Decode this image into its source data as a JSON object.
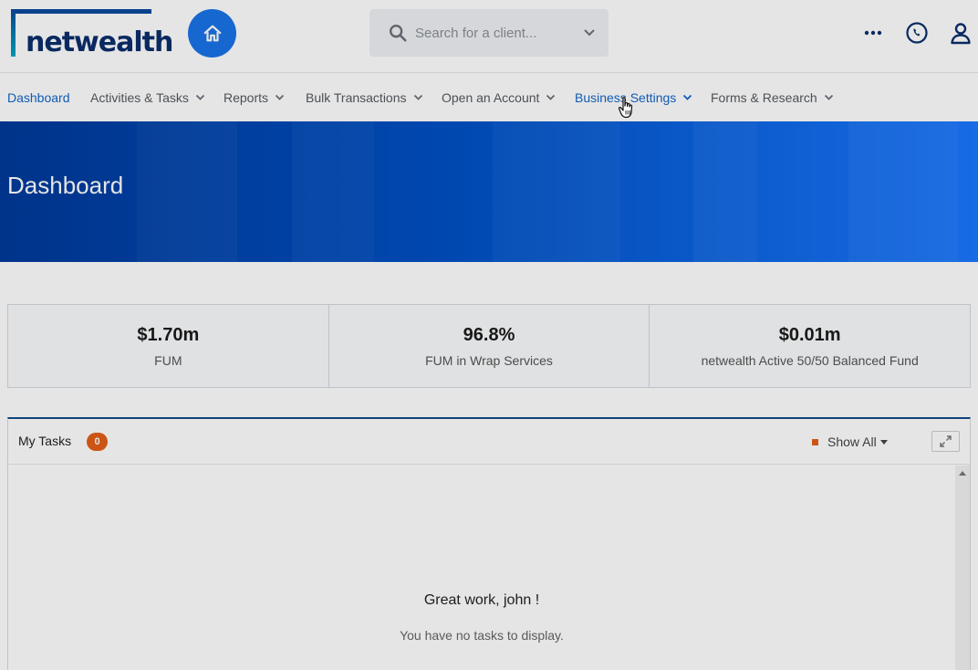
{
  "brand": {
    "name": "netwealth",
    "accent": "#1a73e8",
    "navy": "#0b2e6b"
  },
  "header": {
    "search": {
      "placeholder": "Search for a client...",
      "icon": "search-icon"
    },
    "icons": [
      "more-icon",
      "phone-icon",
      "user-icon"
    ]
  },
  "nav": {
    "items": [
      {
        "label": "Dashboard",
        "dropdown": false,
        "active": true
      },
      {
        "label": "Activities & Tasks",
        "dropdown": true
      },
      {
        "label": "Reports",
        "dropdown": true
      },
      {
        "label": "Bulk Transactions",
        "dropdown": true
      },
      {
        "label": "Open an Account",
        "dropdown": true
      },
      {
        "label": "Business Settings",
        "dropdown": true,
        "hovered": true
      },
      {
        "label": "Forms & Research",
        "dropdown": true
      }
    ]
  },
  "banner": {
    "title": "Dashboard"
  },
  "stats": [
    {
      "value": "$1.70m",
      "label": "FUM"
    },
    {
      "value": "96.8%",
      "label": "FUM in Wrap Services"
    },
    {
      "value": "$0.01m",
      "label": "netwealth Active 50/50 Balanced Fund"
    }
  ],
  "tasks": {
    "title": "My Tasks",
    "count": "0",
    "filter_label": "Show All",
    "empty_title": "Great work, john !",
    "empty_subtitle": "You have no tasks to display.",
    "badge_color": "#e35f18"
  }
}
